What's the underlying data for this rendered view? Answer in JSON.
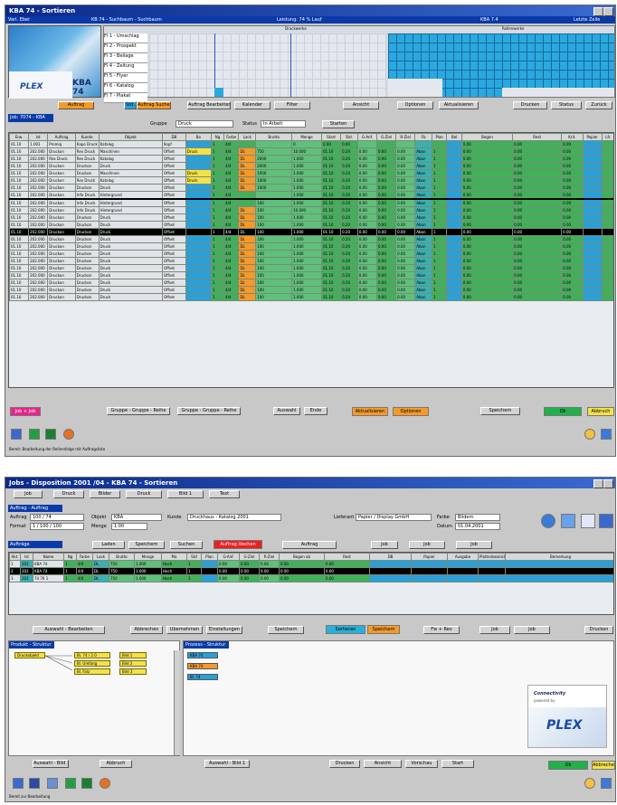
{
  "top_window": {
    "title": "KBA 74 - Sortieren",
    "info_bar": [
      "Vari. Eber",
      "KB 74 - Suchbaum - Suchbaum",
      "Leistung: 74 % Lauf",
      "KBA 7.4",
      "Letzte Zeile"
    ],
    "machine_label": "KBA 74",
    "grid_header_left": "Druckwerke",
    "grid_header_right": "Rollenwerke",
    "schedule_rows": [
      "Fl 1 - Umschlag",
      "Fl 2 - Prospekt",
      "Fl 3 - Beilage",
      "Fl 4 - Zeitung",
      "Fl 5 - Flyer",
      "Fl 6 - Katalog",
      "Fl 7 - Plakat"
    ],
    "toolbar_buttons": [
      "Auftrag",
      "Std.",
      "Auftrag Suchen",
      "Auftrag Bearbeiten",
      "Kalender",
      "Filter",
      "Ansicht",
      "Optionen",
      "Aktualisieren",
      "Drucken",
      "Status",
      "Zurück"
    ],
    "job_field": "Job: 7074 - KBA",
    "group_label": "Gruppe",
    "group_value": "Druck",
    "status_label": "Status",
    "status_value": "In Arbeit",
    "start_button": "Starten",
    "columns": [
      "Erw.",
      "Ist",
      "Auftrag",
      "Kunde",
      "Objekt",
      "DB",
      "Bo",
      "Ng",
      "Farbe",
      "Lack",
      "Brutto",
      "Menge",
      "Start",
      "Std.",
      "G-Anf.",
      "G-Ziel",
      "R-Ziel",
      "Fb",
      "Plan",
      "Bel",
      "Bogen",
      "Rest",
      "Krit.",
      "Papier",
      "Lfr."
    ],
    "rows": [
      {
        "erw": "01.10",
        "ist": "1.001",
        "auftrag": "Promiq",
        "kunde": "Kapo Druck",
        "objekt": "Katalog",
        "db": "Kopf",
        "bo": "",
        "ng": "1",
        "farbe": "4/4",
        "lack": "",
        "brutto": "",
        "menge": "0",
        "start": "0.00",
        "std": "0.00",
        "ganf": "",
        "gziel": "",
        "rziel": "",
        "fb": "",
        "plan": "",
        "bel": "",
        "bogen": "0.00",
        "rest": "0.00",
        "krit": "0.00",
        "papier": "",
        "sep": false,
        "sel": false
      },
      {
        "erw": "01.10",
        "ist": "202.000",
        "auftrag": "Druckon",
        "kunde": "Rex Druck",
        "objekt": "Maschinen",
        "db": "Offset",
        "bo": "Druck",
        "ng": "1",
        "farbe": "4/4",
        "lack": "DL",
        "brutto": "750",
        "menge": "10.000",
        "start": "01.10",
        "std": "0.20",
        "ganf": "0.00",
        "gziel": "0.00",
        "rziel": "0.00",
        "fb": "Abon",
        "plan": "1",
        "bel": "",
        "bogen": "0.00",
        "rest": "0.00",
        "krit": "0.00",
        "papier": "",
        "sep": false,
        "sel": false
      },
      {
        "erw": "01.10",
        "ist": "202.000",
        "auftrag": "Rex Druck",
        "kunde": "Rex Druck",
        "objekt": "Katalog",
        "db": "Offset",
        "bo": "",
        "ng": "1",
        "farbe": "4/4",
        "lack": "DL",
        "brutto": "2000",
        "menge": "1.000",
        "start": "01.10",
        "std": "0.20",
        "ganf": "0.00",
        "gziel": "0.00",
        "rziel": "0.00",
        "fb": "Abon",
        "plan": "1",
        "bel": "",
        "bogen": "0.00",
        "rest": "0.00",
        "krit": "0.00",
        "papier": "",
        "sep": false,
        "sel": false
      },
      {
        "erw": "01.10",
        "ist": "202.000",
        "auftrag": "Druckon",
        "kunde": "Druckon",
        "objekt": "Druck",
        "db": "Offset",
        "bo": "",
        "ng": "1",
        "farbe": "4/4",
        "lack": "DL",
        "brutto": "2000",
        "menge": "1.000",
        "start": "01.10",
        "std": "0.20",
        "ganf": "0.00",
        "gziel": "0.00",
        "rziel": "0.00",
        "fb": "Abon",
        "plan": "1",
        "bel": "",
        "bogen": "0.00",
        "rest": "0.00",
        "krit": "0.00",
        "papier": "",
        "sep": false,
        "sel": false
      },
      {
        "erw": "01.10",
        "ist": "202.000",
        "auftrag": "Druckon",
        "kunde": "Druckon",
        "objekt": "Maschinen",
        "db": "Offset",
        "bo": "Druck",
        "ng": "1",
        "farbe": "4/4",
        "lack": "DL",
        "brutto": "1000",
        "menge": "1.000",
        "start": "01.10",
        "std": "0.20",
        "ganf": "0.00",
        "gziel": "0.00",
        "rziel": "0.00",
        "fb": "Abon",
        "plan": "1",
        "bel": "",
        "bogen": "0.00",
        "rest": "0.00",
        "krit": "0.00",
        "papier": "",
        "sep": false,
        "sel": false
      },
      {
        "erw": "01.10",
        "ist": "202.000",
        "auftrag": "Druckon",
        "kunde": "Rex Druck",
        "objekt": "Katalog",
        "db": "Offset",
        "bo": "Druck",
        "ng": "1",
        "farbe": "4/4",
        "lack": "DL",
        "brutto": "1000",
        "menge": "1.000",
        "start": "01.10",
        "std": "0.20",
        "ganf": "0.00",
        "gziel": "0.00",
        "rziel": "0.00",
        "fb": "Abon",
        "plan": "1",
        "bel": "",
        "bogen": "0.00",
        "rest": "0.00",
        "krit": "0.00",
        "papier": "",
        "sep": false,
        "sel": false
      },
      {
        "erw": "01.10",
        "ist": "202.000",
        "auftrag": "Druckon",
        "kunde": "Druckon",
        "objekt": "Druck",
        "db": "Offset",
        "bo": "",
        "ng": "1",
        "farbe": "4/4",
        "lack": "DL",
        "brutto": "1000",
        "menge": "1.000",
        "start": "01.10",
        "std": "0.20",
        "ganf": "0.00",
        "gziel": "0.00",
        "rziel": "0.00",
        "fb": "Abon",
        "plan": "1",
        "bel": "",
        "bogen": "0.00",
        "rest": "0.00",
        "krit": "0.00",
        "papier": "",
        "sep": false,
        "sel": false
      },
      {
        "erw": "01.10",
        "ist": "202.000",
        "auftrag": "Druckon",
        "kunde": "Info Druck",
        "objekt": "Hintergrund",
        "db": "Offset",
        "bo": "",
        "ng": "1",
        "farbe": "4/4",
        "lack": "",
        "brutto": "",
        "menge": "1.000",
        "start": "01.10",
        "std": "0.20",
        "ganf": "0.00",
        "gziel": "0.00",
        "rziel": "0.00",
        "fb": "Abon",
        "plan": "1",
        "bel": "",
        "bogen": "0.00",
        "rest": "0.00",
        "krit": "0.00",
        "papier": "",
        "sep": false,
        "sel": false
      },
      {
        "erw": "01.10",
        "ist": "202.000",
        "auftrag": "Druckon",
        "kunde": "Info Druck",
        "objekt": "Hintergrund",
        "db": "Offset",
        "bo": "",
        "ng": "1",
        "farbe": "4/4",
        "lack": "",
        "brutto": "100",
        "menge": "1.000",
        "start": "01.10",
        "std": "0.20",
        "ganf": "0.00",
        "gziel": "0.00",
        "rziel": "0.00",
        "fb": "Abon",
        "plan": "1",
        "bel": "",
        "bogen": "0.00",
        "rest": "0.00",
        "krit": "0.00",
        "papier": "",
        "sep": true,
        "sel": false
      },
      {
        "erw": "01.10",
        "ist": "202.000",
        "auftrag": "Druckon",
        "kunde": "Info Druck",
        "objekt": "Hintergrund",
        "db": "Offset",
        "bo": "",
        "ng": "1",
        "farbe": "4/4",
        "lack": "DL",
        "brutto": "100",
        "menge": "10.000",
        "start": "01.10",
        "std": "0.20",
        "ganf": "0.00",
        "gziel": "0.00",
        "rziel": "0.00",
        "fb": "Abon",
        "plan": "1",
        "bel": "",
        "bogen": "0.00",
        "rest": "0.00",
        "krit": "0.00",
        "papier": "",
        "sep": false,
        "sel": false
      },
      {
        "erw": "01.10",
        "ist": "202.000",
        "auftrag": "Druckon",
        "kunde": "Druckon",
        "objekt": "Druck",
        "db": "Offset",
        "bo": "",
        "ng": "1",
        "farbe": "4/4",
        "lack": "DL",
        "brutto": "100",
        "menge": "1.000",
        "start": "01.10",
        "std": "0.20",
        "ganf": "0.00",
        "gziel": "0.00",
        "rziel": "0.00",
        "fb": "Abon",
        "plan": "1",
        "bel": "",
        "bogen": "0.00",
        "rest": "0.00",
        "krit": "0.00",
        "papier": "",
        "sep": false,
        "sel": false
      },
      {
        "erw": "01.10",
        "ist": "202.000",
        "auftrag": "Druckon",
        "kunde": "Druckon",
        "objekt": "Druck",
        "db": "Offset",
        "bo": "",
        "ng": "1",
        "farbe": "4/4",
        "lack": "DL",
        "brutto": "100",
        "menge": "1.000",
        "start": "01.10",
        "std": "0.20",
        "ganf": "0.00",
        "gziel": "0.00",
        "rziel": "0.00",
        "fb": "Abon",
        "plan": "1",
        "bel": "",
        "bogen": "0.00",
        "rest": "0.00",
        "krit": "0.00",
        "papier": "",
        "sep": false,
        "sel": false
      },
      {
        "erw": "01.10",
        "ist": "202.000",
        "auftrag": "Druckon",
        "kunde": "Druckon",
        "objekt": "Druck",
        "db": "Offset",
        "bo": "",
        "ng": "1",
        "farbe": "4/4",
        "lack": "DL",
        "brutto": "100",
        "menge": "1.000",
        "start": "01.10",
        "std": "0.20",
        "ganf": "0.00",
        "gziel": "0.00",
        "rziel": "0.00",
        "fb": "Abon",
        "plan": "1",
        "bel": "",
        "bogen": "0.00",
        "rest": "0.00",
        "krit": "0.00",
        "papier": "",
        "sep": false,
        "sel": true
      },
      {
        "erw": "01.10",
        "ist": "202.000",
        "auftrag": "Druckon",
        "kunde": "Druckon",
        "objekt": "Druck",
        "db": "Offset",
        "bo": "",
        "ng": "1",
        "farbe": "4/4",
        "lack": "DL",
        "brutto": "100",
        "menge": "1.000",
        "start": "01.10",
        "std": "0.20",
        "ganf": "0.00",
        "gziel": "0.00",
        "rziel": "0.00",
        "fb": "Abon",
        "plan": "1",
        "bel": "",
        "bogen": "0.00",
        "rest": "0.00",
        "krit": "0.00",
        "papier": "",
        "sep": false,
        "sel": false
      },
      {
        "erw": "01.10",
        "ist": "202.000",
        "auftrag": "Druckon",
        "kunde": "Druckon",
        "objekt": "Druck",
        "db": "Offset",
        "bo": "",
        "ng": "1",
        "farbe": "4/4",
        "lack": "DL",
        "brutto": "100",
        "menge": "1.000",
        "start": "01.10",
        "std": "0.20",
        "ganf": "0.00",
        "gziel": "0.00",
        "rziel": "0.00",
        "fb": "Abon",
        "plan": "1",
        "bel": "",
        "bogen": "0.00",
        "rest": "0.00",
        "krit": "0.00",
        "papier": "",
        "sep": false,
        "sel": false
      },
      {
        "erw": "01.10",
        "ist": "202.000",
        "auftrag": "Druckon",
        "kunde": "Druckon",
        "objekt": "Druck",
        "db": "Offset",
        "bo": "",
        "ng": "1",
        "farbe": "4/4",
        "lack": "DL",
        "brutto": "100",
        "menge": "1.000",
        "start": "01.10",
        "std": "0.20",
        "ganf": "0.00",
        "gziel": "0.00",
        "rziel": "0.00",
        "fb": "Abon",
        "plan": "1",
        "bel": "",
        "bogen": "0.00",
        "rest": "0.00",
        "krit": "0.00",
        "papier": "",
        "sep": false,
        "sel": false
      },
      {
        "erw": "01.10",
        "ist": "202.000",
        "auftrag": "Druckon",
        "kunde": "Druckon",
        "objekt": "Druck",
        "db": "Offset",
        "bo": "",
        "ng": "1",
        "farbe": "4/4",
        "lack": "DL",
        "brutto": "100",
        "menge": "1.000",
        "start": "01.10",
        "std": "0.20",
        "ganf": "0.00",
        "gziel": "0.00",
        "rziel": "0.00",
        "fb": "Abon",
        "plan": "1",
        "bel": "",
        "bogen": "0.00",
        "rest": "0.00",
        "krit": "0.00",
        "papier": "",
        "sep": false,
        "sel": false
      },
      {
        "erw": "01.10",
        "ist": "202.000",
        "auftrag": "Druckon",
        "kunde": "Druckon",
        "objekt": "Druck",
        "db": "Offset",
        "bo": "",
        "ng": "1",
        "farbe": "4/4",
        "lack": "DL",
        "brutto": "100",
        "menge": "1.000",
        "start": "01.10",
        "std": "0.20",
        "ganf": "0.00",
        "gziel": "0.00",
        "rziel": "0.00",
        "fb": "Abon",
        "plan": "1",
        "bel": "",
        "bogen": "0.00",
        "rest": "0.00",
        "krit": "0.00",
        "papier": "",
        "sep": false,
        "sel": false
      },
      {
        "erw": "01.10",
        "ist": "202.000",
        "auftrag": "Druckon",
        "kunde": "Druckon",
        "objekt": "Druck",
        "db": "Offset",
        "bo": "",
        "ng": "1",
        "farbe": "4/4",
        "lack": "DL",
        "brutto": "100",
        "menge": "1.000",
        "start": "01.10",
        "std": "0.20",
        "ganf": "0.00",
        "gziel": "0.00",
        "rziel": "0.00",
        "fb": "Abon",
        "plan": "1",
        "bel": "",
        "bogen": "0.00",
        "rest": "0.00",
        "krit": "0.00",
        "papier": "",
        "sep": false,
        "sel": false
      },
      {
        "erw": "01.10",
        "ist": "202.000",
        "auftrag": "Druckon",
        "kunde": "Druckon",
        "objekt": "Druck",
        "db": "Offset",
        "bo": "",
        "ng": "1",
        "farbe": "4/4",
        "lack": "DL",
        "brutto": "100",
        "menge": "1.000",
        "start": "01.10",
        "std": "0.20",
        "ganf": "0.00",
        "gziel": "0.00",
        "rziel": "0.00",
        "fb": "Abon",
        "plan": "1",
        "bel": "",
        "bogen": "0.00",
        "rest": "0.00",
        "krit": "0.00",
        "papier": "",
        "sep": false,
        "sel": false
      },
      {
        "erw": "01.10",
        "ist": "202.000",
        "auftrag": "Druckon",
        "kunde": "Druckon",
        "objekt": "Druck",
        "db": "Offset",
        "bo": "",
        "ng": "1",
        "farbe": "4/4",
        "lack": "DL",
        "brutto": "100",
        "menge": "1.000",
        "start": "01.10",
        "std": "0.20",
        "ganf": "0.00",
        "gziel": "0.00",
        "rziel": "0.00",
        "fb": "Abon",
        "plan": "1",
        "bel": "",
        "bogen": "0.00",
        "rest": "0.00",
        "krit": "0.00",
        "papier": "",
        "sep": false,
        "sel": false
      },
      {
        "erw": "01.10",
        "ist": "202.000",
        "auftrag": "Druckon",
        "kunde": "Druckon",
        "objekt": "Druck",
        "db": "Offset",
        "bo": "",
        "ng": "1",
        "farbe": "4/4",
        "lack": "DL",
        "brutto": "100",
        "menge": "1.000",
        "start": "01.10",
        "std": "0.20",
        "ganf": "0.00",
        "gziel": "0.00",
        "rziel": "0.00",
        "fb": "Abon",
        "plan": "1",
        "bel": "",
        "bogen": "0.00",
        "rest": "0.00",
        "krit": "0.00",
        "papier": "",
        "sep": false,
        "sel": false
      }
    ],
    "bottom_buttons": [
      "Job + Job",
      "Gruppe - Gruppe - Reihe",
      "Gruppe - Gruppe - Reihe",
      "Auswahl",
      "Ende",
      "Aktualisieren",
      "Optionen",
      "Speichern",
      "Ok",
      "Abbruch"
    ],
    "status_text": "Bereit: Bearbeitung der Reihenfolge mit Auftragsliste"
  },
  "bottom_window": {
    "title": "Jobs - Disposition 2001 /04 - KBA 74 - Sortieren",
    "tabs": [
      "Job",
      "Druck",
      "Bilder",
      "Druck",
      "Bild 1",
      "Text"
    ],
    "section_header": "Auftrag - Auftrag",
    "fields": [
      {
        "label": "Auftrag",
        "value": "100 / 74"
      },
      {
        "label": "Objekt",
        "value": "KBA"
      },
      {
        "label": "Kunde",
        "value": "Druckhaus - Katalog 2001"
      },
      {
        "label": "Lieferant",
        "value": "Papier / Display GmbH"
      },
      {
        "label": "Farbe",
        "value": "Bildern"
      },
      {
        "label": "Format",
        "value": "1 / 100 / 100"
      },
      {
        "label": "Menge",
        "value": "1.00"
      },
      {
        "label": "Datum",
        "value": "01.04.2001"
      }
    ],
    "subbar": "Aufträge",
    "action_buttons": [
      "Laden",
      "Speichern",
      "Suchen",
      "Auftrag löschen",
      "Auftrag",
      "Job",
      "Job",
      "Job"
    ],
    "columns": [
      "Akt.",
      "Ist",
      "Name",
      "Ng",
      "Farbe",
      "Lack",
      "Brutto",
      "Menge",
      "Ma",
      "Std",
      "Plan",
      "G-Anf.",
      "G-Ziel",
      "R-Ziel",
      "Bogen ab",
      "Rest",
      "DB",
      "Papier",
      "Ausgabe",
      "Plattenbezeichnung",
      "Bemerkung"
    ],
    "rows": [
      {
        "akt": "1",
        "ist": "202",
        "name": "KBA 74",
        "ng": "1",
        "farbe": "4/4",
        "lack": "DL",
        "brutto": "750",
        "menge": "1.000",
        "ma": "Hoch",
        "std": "1",
        "plan": "",
        "ganf": "0.00",
        "gziel": "0.00",
        "rziel": "0.00",
        "bogen": "0.00",
        "rest": "0.00",
        "sel": false
      },
      {
        "akt": "2",
        "ist": "202",
        "name": "KBA 74",
        "ng": "1",
        "farbe": "4/4",
        "lack": "DL",
        "brutto": "750",
        "menge": "1.000",
        "ma": "Hoch",
        "std": "1",
        "plan": "",
        "ganf": "0.00",
        "gziel": "0.00",
        "rziel": "0.00",
        "bogen": "0.00",
        "rest": "0.00",
        "sel": true
      },
      {
        "akt": "3",
        "ist": "202",
        "name": "74 76 1",
        "ng": "1",
        "farbe": "4/4",
        "lack": "DL",
        "brutto": "750",
        "menge": "1.000",
        "ma": "Hoch",
        "std": "1",
        "plan": "",
        "ganf": "0.00",
        "gziel": "0.00",
        "rziel": "0.00",
        "bogen": "0.00",
        "rest": "0.00",
        "sel": false
      }
    ],
    "middle_buttons": [
      "Auswahl - Bearbeiten",
      "Abbrechen",
      "Übernehmen",
      "Einstellungen",
      "Speichern",
      "Sortieren",
      "Speichern",
      "Fw + Rev",
      "Job",
      "Job",
      "Drucken"
    ],
    "left_panel_title": "Produkt - Struktur",
    "tree_root": "Druckobjekt",
    "tree_children": [
      "Bl. 74 / 2.0",
      "Bl. Umfang",
      "Bl. Falz"
    ],
    "tree_leaves": [
      "Bild 1",
      "Bild 2",
      "Bild 3"
    ],
    "right_panel_title": "Prozess - Struktur",
    "process_nodes": [
      "KBA 74",
      "KBA 74",
      "Bl. 74"
    ],
    "logo_title": "Connectivity",
    "logo_sub": "powered by",
    "logo_word": "PLEX",
    "footer_left": [
      "Auswahl - Bild 1",
      "Abbruch"
    ],
    "footer_mid": [
      "Auswahl - Bild 1"
    ],
    "footer_right": [
      "Drucken",
      "Ansicht",
      "Vorschau",
      "Start"
    ],
    "ok_label": "Ok",
    "cancel_label": "Abbrechen",
    "status_text": "Bereit zur Bearbeitung"
  }
}
